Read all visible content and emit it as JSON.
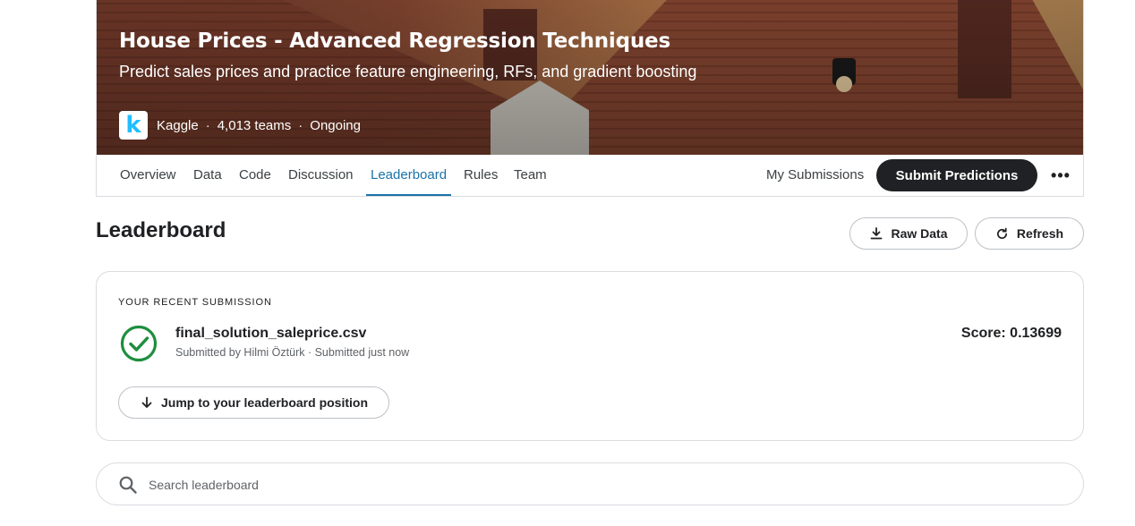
{
  "competition": {
    "title": "House Prices - Advanced Regression Techniques",
    "subtitle": "Predict sales prices and practice feature engineering, RFs, and gradient boosting",
    "logo_letter": "k",
    "host": "Kaggle",
    "teams": "4,013 teams",
    "status": "Ongoing",
    "separator": "·"
  },
  "nav": {
    "tabs": [
      {
        "label": "Overview"
      },
      {
        "label": "Data"
      },
      {
        "label": "Code"
      },
      {
        "label": "Discussion"
      },
      {
        "label": "Leaderboard",
        "active": true
      },
      {
        "label": "Rules"
      },
      {
        "label": "Team"
      }
    ],
    "my_submissions": "My Submissions",
    "submit_predictions": "Submit Predictions",
    "more": "•••"
  },
  "leaderboard": {
    "heading": "Leaderboard",
    "raw_data_label": "Raw Data",
    "refresh_label": "Refresh"
  },
  "recent_submission": {
    "section_label": "YOUR RECENT SUBMISSION",
    "filename": "final_solution_saleprice.csv",
    "submitted_line": "Submitted by Hilmi Öztürk · Submitted just now",
    "score": "Score: 0.13699",
    "jump_label": "Jump to your leaderboard position"
  },
  "search": {
    "placeholder": "Search leaderboard",
    "value": ""
  },
  "colors": {
    "accent": "#1a73a8",
    "primary_button": "#202124",
    "success": "#1e8e3e",
    "kaggle_blue": "#20beff"
  },
  "icons": {
    "download": "download-icon",
    "refresh": "refresh-icon",
    "check": "check-circle-icon",
    "arrow_down": "arrow-down-icon",
    "search": "search-icon",
    "more": "more-horizontal-icon"
  }
}
